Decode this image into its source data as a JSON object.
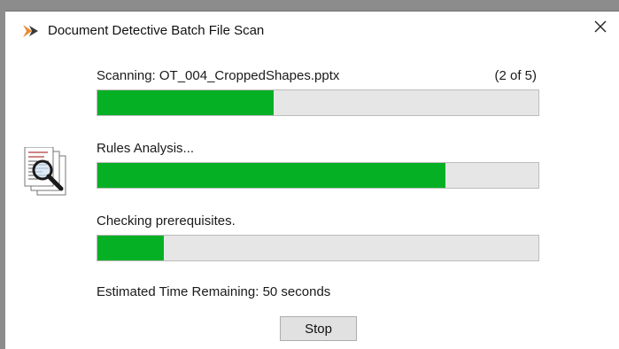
{
  "window": {
    "title": "Document Detective Batch File Scan",
    "close_glyph": "✕",
    "app_icon": "document-detective-logo-icon",
    "close_icon": "close-icon"
  },
  "main": {
    "icon": "document-magnifier-icon",
    "tasks": [
      {
        "label": "Scanning: OT_004_CroppedShapes.pptx",
        "count": "(2 of 5)",
        "progress": 0.4
      },
      {
        "label": "Rules Analysis...",
        "progress": 0.79
      },
      {
        "label": "Checking prerequisites.",
        "progress": 0.15
      }
    ],
    "time_remaining": "Estimated Time Remaining: 50 seconds",
    "stop_label": "Stop"
  },
  "colors": {
    "progress_fill": "#06b025",
    "progress_track": "#e6e6e6",
    "background": "#8c8c8c"
  }
}
